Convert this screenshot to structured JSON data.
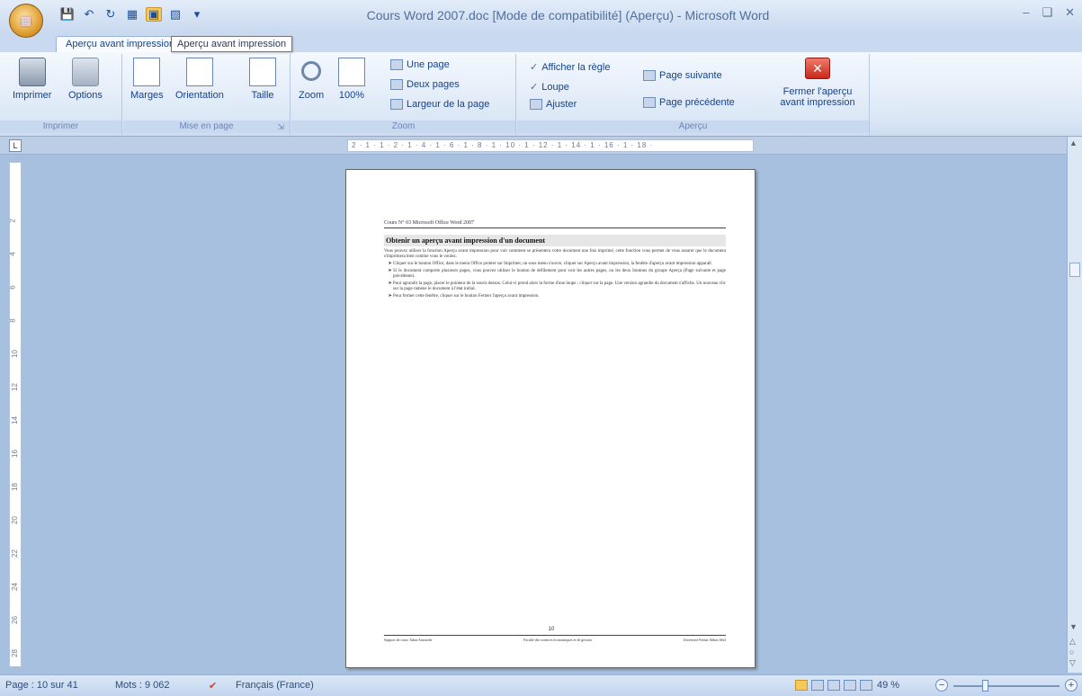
{
  "app": {
    "title": "Cours Word 2007.doc [Mode de compatibilité] (Aperçu) - Microsoft Word",
    "office_button": "",
    "help": "?"
  },
  "tab": {
    "label": "Aperçu avant impression",
    "tooltip": "Aperçu avant impression"
  },
  "ribbon": {
    "imprimer": {
      "label": "Imprimer",
      "print": "Imprimer",
      "options": "Options"
    },
    "mise_en_page": {
      "label": "Mise en page",
      "marges": "Marges",
      "orientation": "Orientation",
      "taille": "Taille"
    },
    "zoom": {
      "label": "Zoom",
      "zoom": "Zoom",
      "pct": "100%",
      "une_page": "Une page",
      "deux_pages": "Deux pages",
      "largeur": "Largeur de la page"
    },
    "apercu": {
      "label": "Aperçu",
      "regle": "Afficher la règle",
      "loupe": "Loupe",
      "ajuster": "Ajuster",
      "suivante": "Page suivante",
      "precedente": "Page précédente",
      "fermer": "Fermer l'aperçu avant impression"
    }
  },
  "ruler": {
    "h": "2 · 1 · 1 · 2 · 1 · 4 · 1 · 6 · 1 · 8 · 1 · 10 · 1 · 12 · 1 · 14 · 1 · 16 · 1 · 18 ·",
    "v": [
      "2",
      "4",
      "6",
      "8",
      "10",
      "12",
      "14",
      "16",
      "18",
      "20",
      "22",
      "24",
      "26",
      "28"
    ]
  },
  "document": {
    "header": "Cours N° 03   Microsoft Office Word 2007",
    "title": "Obtenir un aperçu avant impression d'un document",
    "intro": "Vous pouvez utiliser la fonction Aperçu avant impression pour voir comment se présentera votre document une fois imprimé, cette fonction vous permet de vous assurer que le document s'imprimera bien comme vous le voulez.",
    "bullets": [
      "Cliquer sur le bouton Office, dans le menu Office pointer sur Imprimer, un sous menu s'ouvre, cliquer sur Aperçu avant impression, la fenêtre d'aperçu avant impression apparaît.",
      "Si le document comporte plusieurs pages, vous pouvez utiliser le bouton de défilement pour voir les autres pages, ou les deux boutons du groupe Aperçu (Page suivante et page précédente).",
      "Pour agrandir la page, placer le pointeur de la souris dessus. Celui-ci prend alors la forme d'une loupe ; cliquer sur la page. Une version agrandie du document s'affiche. Un nouveau clic sur la page ramène le document à l'état initial.",
      "Pour fermer cette fenêtre, cliquer sur le bouton Fermer l'aperçu avant impression."
    ],
    "page_number": "10",
    "footer_left": "Support de cours   Tahar Ainouche",
    "footer_mid": "Faculté des sciences économiques et de gestion",
    "footer_right": "Université Ferhat Abbas Sétif"
  },
  "status": {
    "page": "Page : 10 sur 41",
    "mots": "Mots : 9 062",
    "langue": "Français (France)",
    "zoom": "49 %",
    "minus": "−",
    "plus": "+"
  }
}
